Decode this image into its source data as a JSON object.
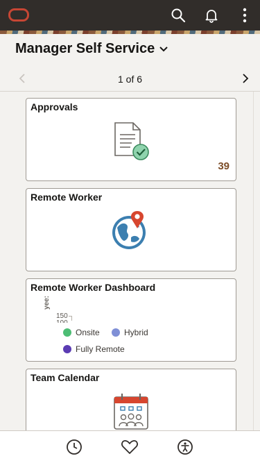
{
  "topbar": {
    "logo_icon": "oracle-logo",
    "search_icon": "search-icon",
    "notifications_icon": "bell-icon",
    "more_icon": "more-vertical-icon"
  },
  "header": {
    "title": "Manager Self Service",
    "pager_text": "1 of 6"
  },
  "tiles": [
    {
      "title": "Approvals",
      "count": "39",
      "icon": "document-check-icon"
    },
    {
      "title": "Remote Worker",
      "icon": "globe-location-icon"
    },
    {
      "title": "Remote Worker Dashboard",
      "chart": {
        "axis_label": "yee:",
        "ticks": [
          "150",
          "100"
        ],
        "legend": [
          {
            "label": "Onsite",
            "color": "#4dbd74"
          },
          {
            "label": "Hybrid",
            "color": "#7f8fd6"
          },
          {
            "label": "Fully Remote",
            "color": "#5b3cb3"
          }
        ]
      }
    },
    {
      "title": "Team Calendar",
      "icon": "calendar-team-icon"
    }
  ],
  "bottom_bar": {
    "recent_icon": "clock-icon",
    "favorites_icon": "heart-icon",
    "accessibility_icon": "accessibility-icon"
  },
  "colors": {
    "topbar_bg": "#312d2a",
    "brand_red": "#c74634",
    "count_color": "#7c4d28"
  }
}
